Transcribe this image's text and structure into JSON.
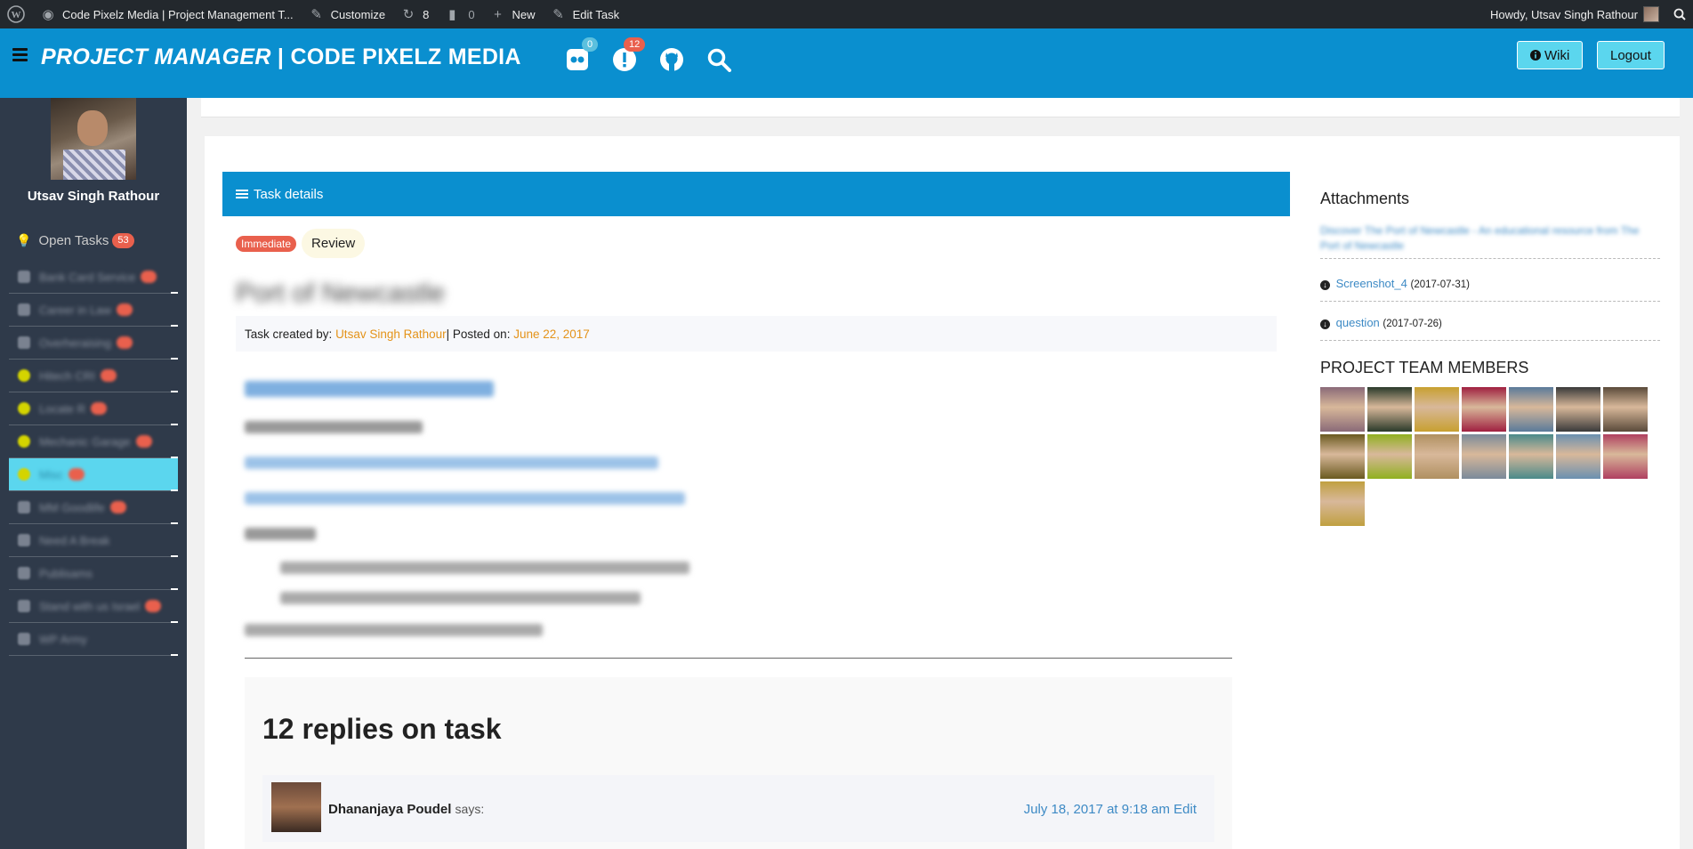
{
  "adminbar": {
    "site_title": "Code Pixelz Media | Project Management T...",
    "customize": "Customize",
    "updates_count": "8",
    "comments_count": "0",
    "new_label": "New",
    "edit_task": "Edit Task",
    "howdy": "Howdy, Utsav Singh Rathour"
  },
  "header": {
    "brand_italic": "PROJECT MANAGER",
    "brand_sep": " | ",
    "brand_rest": "CODE PIXELZ MEDIA",
    "flickr_badge": "0",
    "alert_badge": "12",
    "wiki_label": "Wiki",
    "logout_label": "Logout"
  },
  "sidebar": {
    "user_name": "Utsav Singh Rathour",
    "open_tasks_label": "Open Tasks",
    "open_tasks_count": "53",
    "active_index": 6,
    "items": [
      {
        "label": "Bank Card Service",
        "icon": "star-icon-blur",
        "star": false,
        "badge": true
      },
      {
        "label": "Career in Law",
        "star": false,
        "badge": true
      },
      {
        "label": "Overheraising",
        "star": false,
        "badge": true
      },
      {
        "label": "Hitech CRI",
        "star": true,
        "badge": true
      },
      {
        "label": "Locate R",
        "star": true,
        "badge": true
      },
      {
        "label": "Mechanic Garage",
        "star": true,
        "badge": true
      },
      {
        "label": "Misc",
        "star": true,
        "badge": true
      },
      {
        "label": "MM Goodlife",
        "star": false,
        "badge": true
      },
      {
        "label": "Need A Break",
        "star": false,
        "badge": false
      },
      {
        "label": "Publisams",
        "star": false,
        "badge": false
      },
      {
        "label": "Stand with us Israel",
        "star": false,
        "badge": true
      },
      {
        "label": "WP Army",
        "star": false,
        "badge": false
      }
    ]
  },
  "task": {
    "panel_title": "Task details",
    "priority": "Immediate",
    "status": "Review",
    "title": "Port of Newcastle",
    "created_by_label": "Task created by:",
    "created_by": "Utsav Singh Rathour",
    "posted_on_label": " | Posted on:",
    "posted_on": "June 22, 2017"
  },
  "replies": {
    "heading": "12 replies on task",
    "first": {
      "author": "Dhananjaya Poudel",
      "says": "says:",
      "date": "July 18, 2017 at 9:18 am",
      "edit": "Edit"
    }
  },
  "attachments": {
    "title": "Attachments",
    "items": [
      {
        "name": "Discover The Port of Newcastle - An educational resource from The Port of Newcastle",
        "date": ""
      },
      {
        "name": "Screenshot_4",
        "date": "(2017-07-31)"
      },
      {
        "name": "question",
        "date": "(2017-07-26)"
      }
    ]
  },
  "team": {
    "title": "PROJECT TEAM MEMBERS",
    "colors": [
      "#8a6a78",
      "#2a3a2a",
      "#c8a030",
      "#a02040",
      "#5a7a9a",
      "#3a3a3a",
      "#5a4a3a",
      "#6a5a20",
      "#90b020",
      "#b09060",
      "#7a8a9a",
      "#4a8a8a",
      "#6a90b0",
      "#b04060",
      "#c0a040"
    ]
  }
}
